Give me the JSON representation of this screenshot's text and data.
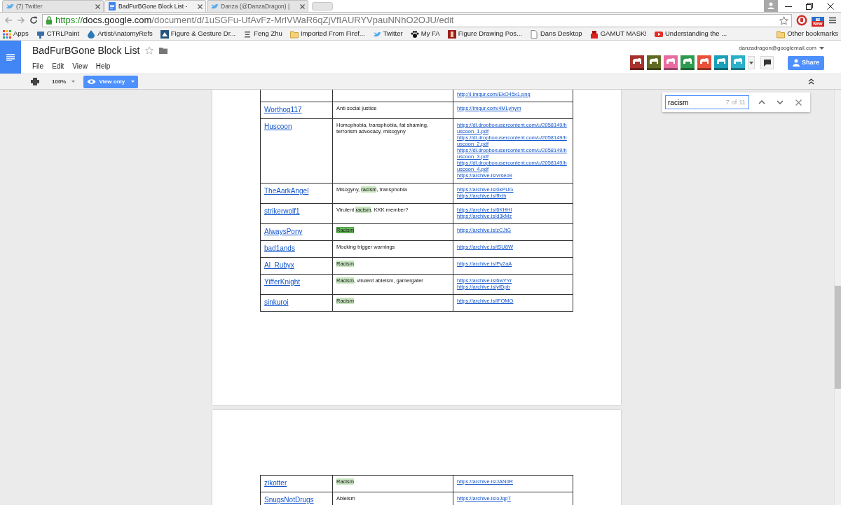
{
  "browser": {
    "tabs": [
      {
        "title": "(7) Twitter",
        "selected": false
      },
      {
        "title": "BadFurBGone Block List -",
        "selected": true
      },
      {
        "title": "Danza (@DanzaDragon) |",
        "selected": false
      }
    ],
    "url": {
      "scheme": "https://",
      "host": "docs.google.com",
      "path": "/document/d/1uSGFu-UfAvFz-MrlVWaR6qZjVfIAURYVpauNNhO2OJU/edit"
    },
    "extension_badge": "New",
    "bookmarks": [
      "Apps",
      "CTRLPaint",
      "ArtistAnatomyRefs",
      "Figure & Gesture Dr...",
      "Feng Zhu",
      "Imported From Firef...",
      "Twitter",
      "My FA",
      "Figure Drawing Pos...",
      "Dans Desktop",
      "GAMUT MASK!",
      "Understanding the ..."
    ],
    "other_bookmarks": "Other bookmarks"
  },
  "docs": {
    "title": "BadFurBGone Block List",
    "menu": [
      "File",
      "Edit",
      "View",
      "Help"
    ],
    "account": "danzadragon@googlemail.com",
    "extensions": [
      {
        "color": "#a8312b"
      },
      {
        "color": "#5f6b22"
      },
      {
        "color": "#e86ca0"
      },
      {
        "color": "#2e9a4f"
      },
      {
        "color": "#e8503a"
      },
      {
        "color": "#1aa0b8"
      },
      {
        "color": "#2ab0c8"
      }
    ],
    "share": "Share",
    "zoom": "100%",
    "mode": "View only"
  },
  "find": {
    "query": "racism",
    "count": "7 of 11"
  },
  "pages": [
    {
      "rows": [
        {
          "links": [
            "http://i.imgur.com/EkO45x1.png"
          ]
        },
        {
          "name": "Worthog117",
          "reason": [
            {
              "text": "Anti social justice",
              "highlighted": false,
              "selected": false
            }
          ],
          "links": [
            "https://imgur.com/4MLyhym"
          ]
        },
        {
          "name": "Huscoon",
          "reason": [
            {
              "text": "Homophobia, transphobia, fat shaming, terrorism advocacy, misogyny",
              "highlighted": false,
              "selected": false
            }
          ],
          "links": [
            "https://dl.dropboxusercontent.com/u/2058149/huscoon_1.pdf",
            "https://dl.dropboxusercontent.com/u/2058149/huscoon_2.pdf",
            "https://dl.dropboxusercontent.com/u/2058149/huscoon_3.pdf",
            "https://dl.dropboxusercontent.com/u/2058149/huscoon_4.pdf",
            "https://archive.is/vrseo9"
          ]
        },
        {
          "name": "TheAarkAngel",
          "reason": [
            {
              "text": "Misogyny, ",
              "highlighted": false,
              "selected": false
            },
            {
              "text": "racism",
              "highlighted": true,
              "selected": false
            },
            {
              "text": ", transphobia",
              "highlighted": false,
              "selected": false
            }
          ],
          "links": [
            "https://archive.is/0kPUG",
            "https://archive.is/ffxth"
          ]
        },
        {
          "name": "strikerwolf1",
          "reason": [
            {
              "text": "Virulent ",
              "highlighted": false,
              "selected": false
            },
            {
              "text": "racism",
              "highlighted": true,
              "selected": false
            },
            {
              "text": ", KKK member?",
              "highlighted": false,
              "selected": false
            }
          ],
          "links": [
            "https://archive.is/6KHHI",
            "https://archive.is/d3kMz"
          ]
        },
        {
          "name": "AlwaysPony",
          "reason": [
            {
              "text": "Racism",
              "highlighted": true,
              "selected": true
            }
          ],
          "links": [
            "https://archive.is/zCJtG"
          ]
        },
        {
          "name": "bad1ands",
          "reason": [
            {
              "text": "Mocking trigger warnings",
              "highlighted": false,
              "selected": false
            }
          ],
          "links": [
            "https://archive.is/tSU8W"
          ]
        },
        {
          "name": "Al_Rubyx",
          "reason": [
            {
              "text": "Racism",
              "highlighted": true,
              "selected": false
            }
          ],
          "links": [
            "https://archive.is/Py2aA"
          ]
        },
        {
          "name": "YifferKnight",
          "reason": [
            {
              "text": "Racism",
              "highlighted": true,
              "selected": false
            },
            {
              "text": ", virulent ableism, gamergater",
              "highlighted": false,
              "selected": false
            }
          ],
          "links": [
            "https://archive.is/6wYYr",
            "https://archive.is/yfDpb"
          ]
        },
        {
          "name": "sinkuroi",
          "reason": [
            {
              "text": "Racism",
              "highlighted": true,
              "selected": false
            }
          ],
          "links": [
            "https://archive.is/lFOMO"
          ]
        }
      ]
    },
    {
      "rows": [
        {
          "name": "zikotter",
          "reason": [
            {
              "text": "Racism",
              "highlighted": true,
              "selected": false
            }
          ],
          "links": [
            "https://archive.is/JAN0R"
          ]
        },
        {
          "name": "SnugsNotDrugs",
          "reason": [
            {
              "text": "Ableism",
              "highlighted": false,
              "selected": false
            }
          ],
          "links": [
            "https://archive.is/oJqpT"
          ]
        }
      ]
    }
  ]
}
